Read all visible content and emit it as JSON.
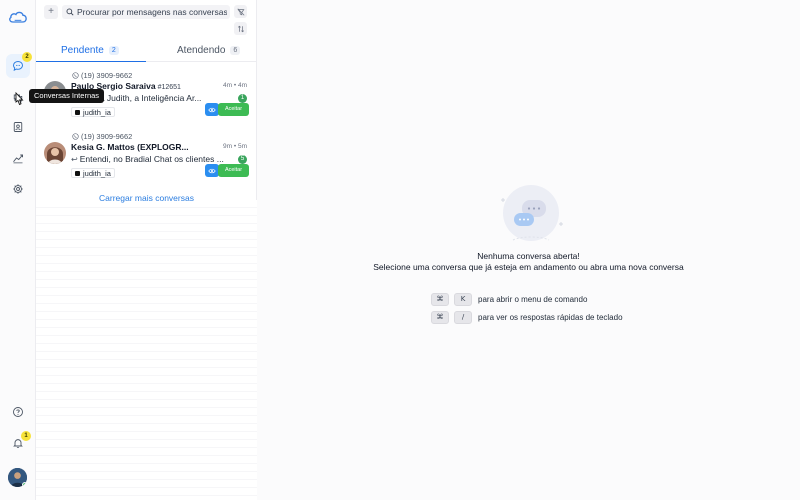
{
  "sidebar": {
    "conversations_badge": "2",
    "notifications_badge": "1",
    "tooltip": "Conversas Internas"
  },
  "list": {
    "search_placeholder": "Procurar por mensagens nas conversas",
    "tabs": [
      {
        "label": "Pendente",
        "count": "2"
      },
      {
        "label": "Atendendo",
        "count": "6"
      }
    ],
    "conversations": [
      {
        "phone": "(19) 3909-9662",
        "name": "Paulo Sergio Saraiva",
        "id": "#12651",
        "time": "4m • 4m",
        "preview": "Eu sou a Judith, a Inteligência Ar...",
        "unread": "1",
        "tag": "judith_ia",
        "accept_label": "Aceitar"
      },
      {
        "phone": "(19) 3909-9662",
        "name": "Kesia G. Mattos (EXPLOGR...",
        "id": "",
        "time": "9m • 5m",
        "preview": "Entendi, no Bradial Chat os clientes ...",
        "unread": "5",
        "tag": "judith_ia",
        "accept_label": "Aceitar"
      }
    ],
    "load_more": "Carregar mais conversas"
  },
  "main": {
    "empty_title": "Nenhuma conversa aberta!",
    "empty_subtitle": "Selecione uma conversa que já esteja em andamento ou abra uma nova conversa",
    "shortcuts": [
      {
        "key1": "⌘",
        "key2": "K",
        "desc": "para abrir o menu de comando"
      },
      {
        "key1": "⌘",
        "key2": "/",
        "desc": "para ver os respostas rápidas de teclado"
      }
    ]
  },
  "colors": {
    "accent": "#1f6fe5",
    "accept_green": "#3dbb54",
    "eye_blue": "#2b8ef0",
    "badge_yellow": "#f7e23a"
  }
}
